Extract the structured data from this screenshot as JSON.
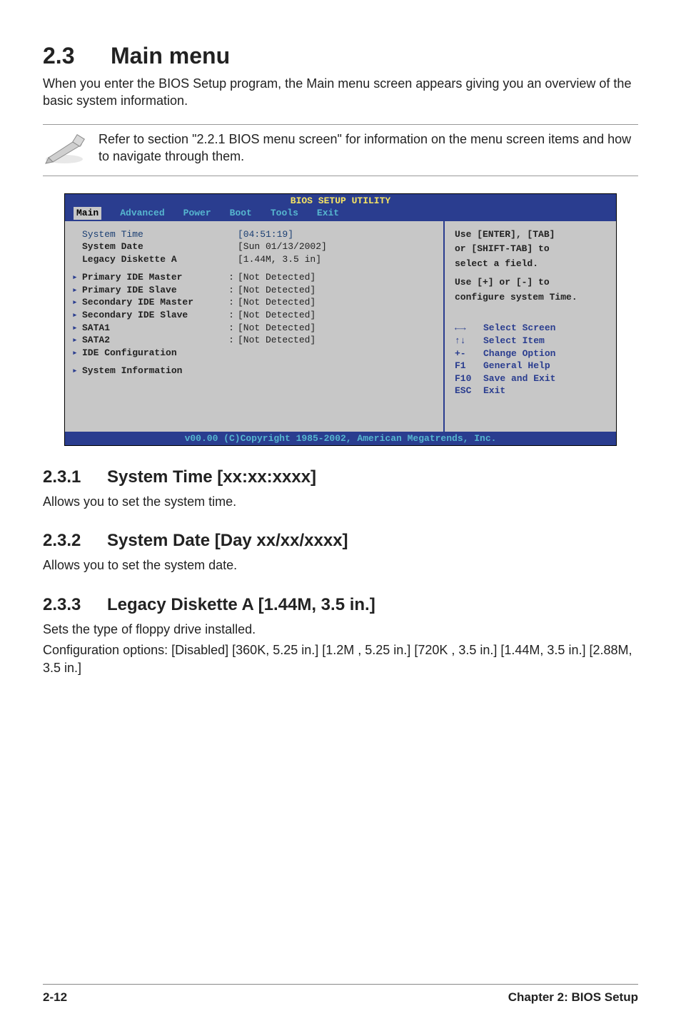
{
  "section": {
    "number": "2.3",
    "title": "Main menu",
    "intro": "When you enter the BIOS Setup program, the Main menu screen appears giving you an overview of the basic system information."
  },
  "note": "Refer to section \"2.2.1  BIOS menu screen\" for information on the menu screen items and how to navigate through them.",
  "bios": {
    "title": "BIOS SETUP UTILITY",
    "menu": [
      "Main",
      "Advanced",
      "Power",
      "Boot",
      "Tools",
      "Exit"
    ],
    "selected_menu": "Main",
    "left": {
      "system_time_label": "System Time",
      "system_time_value": "[04:51:19]",
      "system_date_label": "System Date",
      "system_date_value": "[Sun 01/13/2002]",
      "legacy_label": "Legacy Diskette A",
      "legacy_value": "[1.44M, 3.5 in]",
      "ide": [
        {
          "label": "Primary IDE Master",
          "value": "[Not Detected]"
        },
        {
          "label": "Primary IDE Slave",
          "value": "[Not Detected]"
        },
        {
          "label": "Secondary IDE Master",
          "value": "[Not Detected]"
        },
        {
          "label": "Secondary IDE Slave",
          "value": "[Not Detected]"
        },
        {
          "label": "SATA1",
          "value": "[Not Detected]"
        },
        {
          "label": "SATA2",
          "value": "[Not Detected]"
        }
      ],
      "ide_config": "IDE Configuration",
      "sys_info": "System Information"
    },
    "help": {
      "line1": "Use [ENTER], [TAB]",
      "line2": "or [SHIFT-TAB] to",
      "line3": "select a field.",
      "line4": "Use [+] or [-] to",
      "line5": "configure system Time."
    },
    "keys": [
      {
        "k": "←→",
        "t": "Select Screen"
      },
      {
        "k": "↑↓",
        "t": "Select Item"
      },
      {
        "k": "+-",
        "t": "Change Option"
      },
      {
        "k": "F1",
        "t": "General Help"
      },
      {
        "k": "F10",
        "t": "Save and Exit"
      },
      {
        "k": "ESC",
        "t": "Exit"
      }
    ],
    "copyright": "v00.00 (C)Copyright 1985-2002, American Megatrends, Inc."
  },
  "subsections": {
    "s1": {
      "num": "2.3.1",
      "title": "System Time [xx:xx:xxxx]",
      "body": "Allows you to set the system time."
    },
    "s2": {
      "num": "2.3.2",
      "title": "System Date [Day xx/xx/xxxx]",
      "body": "Allows you to set the system date."
    },
    "s3": {
      "num": "2.3.3",
      "title": "Legacy Diskette A [1.44M, 3.5 in.]",
      "body1": "Sets the type of floppy drive installed.",
      "body2": "Configuration options: [Disabled] [360K, 5.25 in.] [1.2M , 5.25 in.] [720K , 3.5 in.] [1.44M, 3.5 in.] [2.88M, 3.5 in.]"
    }
  },
  "footer": {
    "left": "2-12",
    "right": "Chapter 2: BIOS Setup"
  }
}
